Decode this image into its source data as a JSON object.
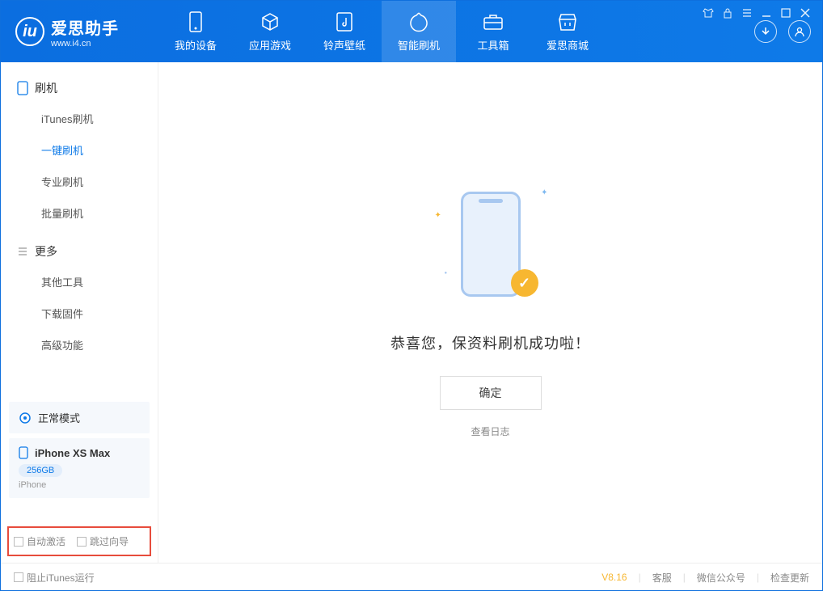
{
  "app": {
    "title": "爱思助手",
    "subtitle": "www.i4.cn"
  },
  "tabs": [
    {
      "label": "我的设备"
    },
    {
      "label": "应用游戏"
    },
    {
      "label": "铃声壁纸"
    },
    {
      "label": "智能刷机"
    },
    {
      "label": "工具箱"
    },
    {
      "label": "爱思商城"
    }
  ],
  "sidebar": {
    "group1_title": "刷机",
    "items1": [
      {
        "label": "iTunes刷机"
      },
      {
        "label": "一键刷机"
      },
      {
        "label": "专业刷机"
      },
      {
        "label": "批量刷机"
      }
    ],
    "group2_title": "更多",
    "items2": [
      {
        "label": "其他工具"
      },
      {
        "label": "下载固件"
      },
      {
        "label": "高级功能"
      }
    ]
  },
  "device": {
    "mode": "正常模式",
    "name": "iPhone XS Max",
    "capacity": "256GB",
    "type": "iPhone"
  },
  "checks": {
    "auto_activate": "自动激活",
    "skip_guide": "跳过向导"
  },
  "main": {
    "success_text": "恭喜您，保资料刷机成功啦！",
    "ok_button": "确定",
    "view_log": "查看日志"
  },
  "footer": {
    "block_itunes": "阻止iTunes运行",
    "version": "V8.16",
    "support": "客服",
    "wechat": "微信公众号",
    "update": "检查更新"
  }
}
